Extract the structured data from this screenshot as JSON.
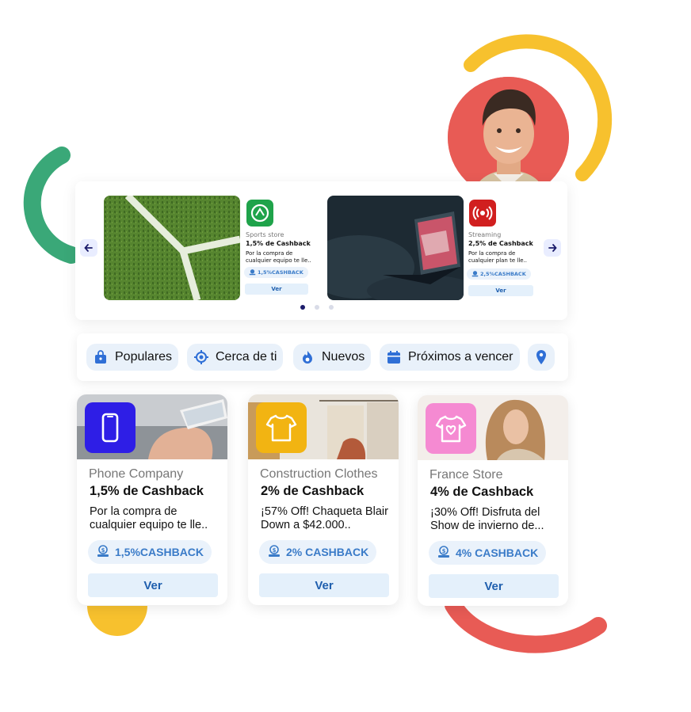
{
  "colors": {
    "green": "#3aa878",
    "yellow": "#f7c12e",
    "red": "#e85b55",
    "accent_blue": "#2f6fd6",
    "badge_bg": "#eaf2fb"
  },
  "carousel": {
    "prev_icon": "arrow-left-icon",
    "next_icon": "arrow-right-icon",
    "slides": [
      {
        "image": "soccer-field-image",
        "logo_icon": "sports-logo-icon",
        "category": "Sports store",
        "title": "1,5% de Cashback",
        "description": "Por la compra de cualquier equipo te lle..",
        "badge": "1,5%CASHBACK",
        "button": "Ver"
      },
      {
        "image": "laptop-dark-image",
        "logo_icon": "streaming-logo-icon",
        "category": "Streaming",
        "title": "2,5% de Cashback",
        "description": "Por la compra de cualquier plan te lle..",
        "badge": "2,5%CASHBACK",
        "button": "Ver"
      }
    ],
    "pagination": {
      "total": 3,
      "active": 0
    }
  },
  "categories": [
    {
      "label": "Populares",
      "icon": "shopping-bag-icon"
    },
    {
      "label": "Cerca de ti",
      "icon": "location-target-icon"
    },
    {
      "label": "Nuevos",
      "icon": "fire-icon"
    },
    {
      "label": "Próximos a vencer",
      "icon": "calendar-icon"
    }
  ],
  "location_icon": "map-pin-icon",
  "products": [
    {
      "icon": "smartphone-icon",
      "icon_color": "#2e1ee6",
      "category": "Phone Company",
      "title": "1,5% de Cashback",
      "description": "Por la compra de cualquier equipo te lle..",
      "badge": "1,5%CASHBACK",
      "button": "Ver"
    },
    {
      "icon": "tshirt-icon",
      "icon_color": "#f2b412",
      "category": "Construction Clothes",
      "title": "2% de Cashback",
      "description": "¡57% Off! Chaqueta Blair Down a $42.000..",
      "badge": "2% CASHBACK",
      "button": "Ver"
    },
    {
      "icon": "heart-shirt-icon",
      "icon_color": "#f58ad2",
      "category": "France Store",
      "title": "4% de Cashback",
      "description": "¡30% Off! Disfruta del Show de invierno de...",
      "badge": "4% CASHBACK",
      "button": "Ver"
    }
  ]
}
